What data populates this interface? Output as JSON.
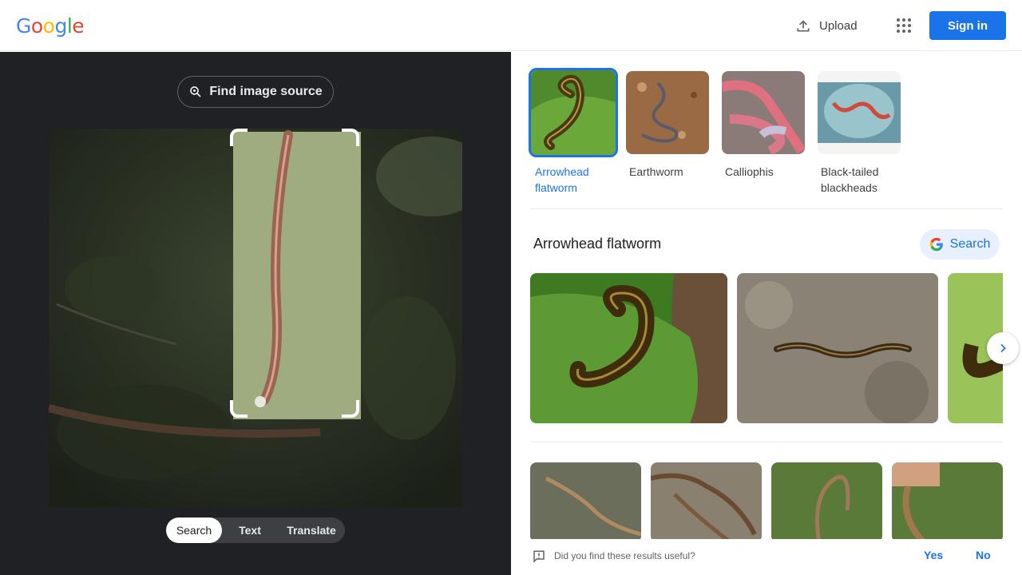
{
  "header": {
    "logo": "Google",
    "upload_label": "Upload",
    "signin_label": "Sign in"
  },
  "lens": {
    "find_source_label": "Find image source",
    "modes": [
      "Search",
      "Text",
      "Translate"
    ],
    "active_mode": "Search"
  },
  "matches": [
    {
      "label": "Arrowhead flatworm",
      "selected": true
    },
    {
      "label": "Earthworm",
      "selected": false
    },
    {
      "label": "Calliophis",
      "selected": false
    },
    {
      "label": "Black-tailed blackheads",
      "selected": false
    }
  ],
  "section": {
    "title": "Arrowhead flatworm",
    "search_label": "Search"
  },
  "feedback": {
    "question": "Did you find these results useful?",
    "yes": "Yes",
    "no": "No"
  },
  "colors": {
    "accent": "#1a73e8",
    "dark_panel": "#202124"
  },
  "icons": [
    "upload-icon",
    "apps-grid-icon",
    "lens-search-icon",
    "google-g-icon",
    "chevron-right-icon",
    "feedback-icon"
  ]
}
